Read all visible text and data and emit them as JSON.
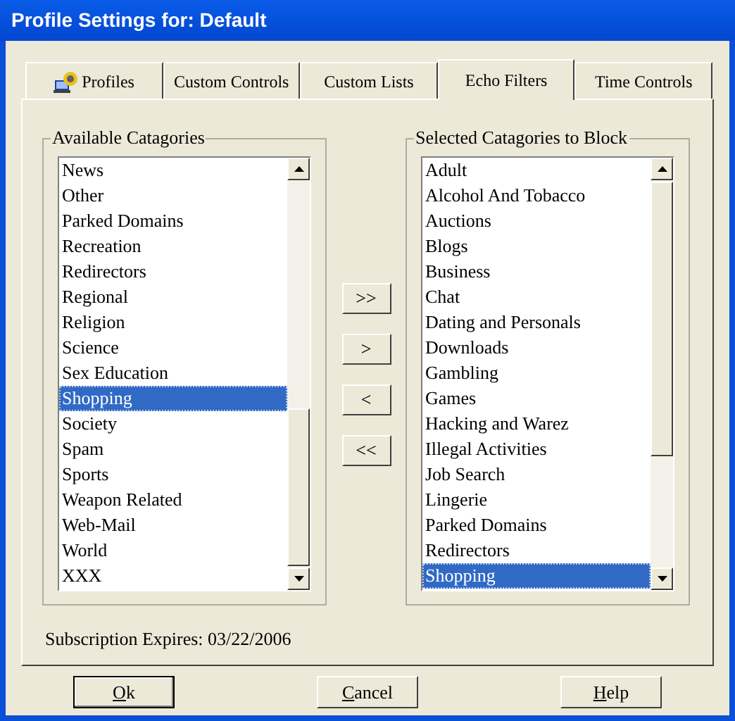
{
  "window": {
    "title": "Profile Settings for: Default"
  },
  "tabs": [
    {
      "label": "Profiles",
      "selected": false
    },
    {
      "label": "Custom Controls",
      "selected": false
    },
    {
      "label": "Custom Lists",
      "selected": false
    },
    {
      "label": "Echo Filters",
      "selected": true
    },
    {
      "label": "Time Controls",
      "selected": false
    }
  ],
  "available": {
    "title": "Available Catagories",
    "items": [
      {
        "label": "News",
        "selected": false
      },
      {
        "label": "Other",
        "selected": false
      },
      {
        "label": "Parked Domains",
        "selected": false
      },
      {
        "label": "Recreation",
        "selected": false
      },
      {
        "label": "Redirectors",
        "selected": false
      },
      {
        "label": "Regional",
        "selected": false
      },
      {
        "label": "Religion",
        "selected": false
      },
      {
        "label": "Science",
        "selected": false
      },
      {
        "label": "Sex Education",
        "selected": false
      },
      {
        "label": "Shopping",
        "selected": true
      },
      {
        "label": "Society",
        "selected": false
      },
      {
        "label": "Spam",
        "selected": false
      },
      {
        "label": "Sports",
        "selected": false
      },
      {
        "label": "Weapon Related",
        "selected": false
      },
      {
        "label": "Web-Mail",
        "selected": false
      },
      {
        "label": "World",
        "selected": false
      },
      {
        "label": "XXX",
        "selected": false
      }
    ]
  },
  "move_buttons": [
    ">>",
    ">",
    "<",
    "<<"
  ],
  "blocked": {
    "title": "Selected Catagories to Block",
    "items": [
      {
        "label": "Adult",
        "selected": false
      },
      {
        "label": "Alcohol And Tobacco",
        "selected": false
      },
      {
        "label": "Auctions",
        "selected": false
      },
      {
        "label": "Blogs",
        "selected": false
      },
      {
        "label": "Business",
        "selected": false
      },
      {
        "label": "Chat",
        "selected": false
      },
      {
        "label": "Dating and Personals",
        "selected": false
      },
      {
        "label": "Downloads",
        "selected": false
      },
      {
        "label": "Gambling",
        "selected": false
      },
      {
        "label": "Games",
        "selected": false
      },
      {
        "label": "Hacking and Warez",
        "selected": false
      },
      {
        "label": "Illegal Activities",
        "selected": false
      },
      {
        "label": "Job Search",
        "selected": false
      },
      {
        "label": "Lingerie",
        "selected": false
      },
      {
        "label": "Parked Domains",
        "selected": false
      },
      {
        "label": "Redirectors",
        "selected": false
      },
      {
        "label": "Shopping",
        "selected": true
      }
    ]
  },
  "subscription": "Subscription Expires: 03/22/2006",
  "buttons": [
    {
      "label": "Ok",
      "default": true
    },
    {
      "label": "Cancel",
      "default": false
    },
    {
      "label": "Help",
      "default": false
    }
  ]
}
